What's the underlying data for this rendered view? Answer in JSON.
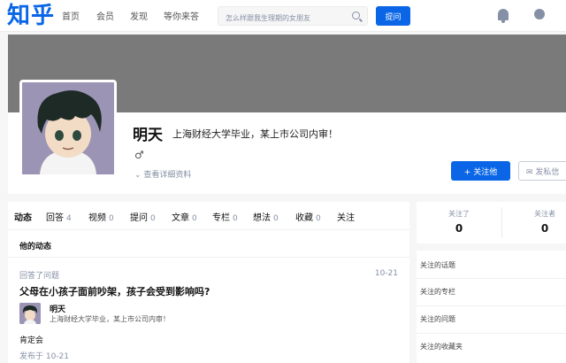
{
  "header": {
    "logo": "知乎",
    "nav": [
      "首页",
      "会员",
      "发现",
      "等你来答"
    ],
    "search_placeholder": "怎么样跟我生理期的女朋友",
    "ask_label": "提问"
  },
  "profile": {
    "name": "明天",
    "headline": "上海财经大学毕业，某上市公司内审！",
    "gender_symbol": "♂",
    "detail_link": "查看详细资料",
    "follow_label": "+ 关注他",
    "message_label": "发私信"
  },
  "tabs": [
    {
      "label": "动态",
      "count": ""
    },
    {
      "label": "回答",
      "count": "4"
    },
    {
      "label": "视频",
      "count": "0"
    },
    {
      "label": "提问",
      "count": "0"
    },
    {
      "label": "文章",
      "count": "0"
    },
    {
      "label": "专栏",
      "count": "0"
    },
    {
      "label": "想法",
      "count": "0"
    },
    {
      "label": "收藏",
      "count": "0"
    },
    {
      "label": "关注",
      "count": ""
    }
  ],
  "activity": {
    "section_title": "他的动态",
    "type": "回答了问题",
    "date": "10-21",
    "question_title": "父母在小孩子面前吵架，孩子会受到影响吗?",
    "author_name": "明天",
    "author_headline": "上海财经大学毕业，某上市公司内审！",
    "answer_excerpt": "肯定会",
    "published": "发布于 10-21"
  },
  "sidebar": {
    "following_label": "关注了",
    "following_count": "0",
    "followers_label": "关注者",
    "followers_count": "0",
    "items": [
      "关注的话题",
      "关注的专栏",
      "关注的问题",
      "关注的收藏夹"
    ]
  },
  "colors": {
    "brand": "#0a66e6",
    "cover": "#7a7a7a",
    "muted": "#8590a6"
  }
}
